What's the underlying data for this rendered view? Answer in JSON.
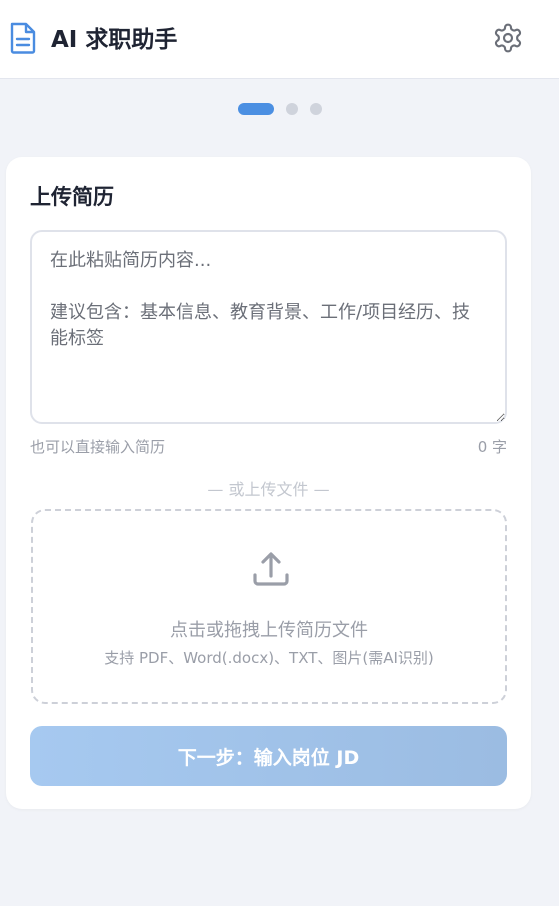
{
  "header": {
    "title": "AI 求职助手",
    "logo_icon": "document-icon",
    "settings_icon": "gear-icon"
  },
  "steps": {
    "total": 3,
    "current": 1
  },
  "upload_section": {
    "title": "上传简历",
    "textarea_placeholder": "在此粘贴简历内容...\n\n建议包含：基本信息、教育背景、工作/项目经历、技能标签",
    "textarea_value": "",
    "hint": "也可以直接输入简历",
    "char_count": "0 字",
    "divider": "— 或上传文件 —",
    "dropzone": {
      "icon": "upload-icon",
      "main_text": "点击或拖拽上传简历文件",
      "sub_text": "支持 PDF、Word(.docx)、TXT、图片(需AI识别)"
    },
    "next_button": "下一步：输入岗位 JD"
  },
  "colors": {
    "accent": "#4b8fe2",
    "button_start": "#a6c9f0",
    "button_end": "#9bbce2",
    "background": "#f1f3f8",
    "icon_blue": "#4a8ce0",
    "icon_gray": "#6b6f78"
  }
}
